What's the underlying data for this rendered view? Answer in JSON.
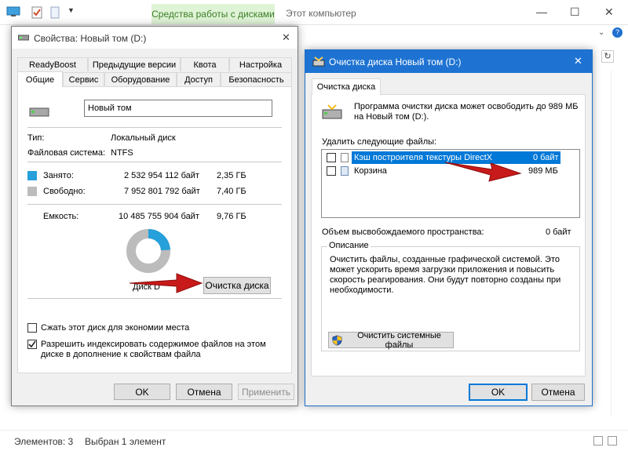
{
  "explorer": {
    "ribbon_tab": "Средства работы с дисками",
    "title": "Этот компьютер",
    "status_items": "Элементов: 3",
    "status_selected": "Выбран 1 элемент"
  },
  "properties": {
    "title": "Свойства: Новый том (D:)",
    "tabs_row1": [
      "ReadyBoost",
      "Предыдущие версии",
      "Квота",
      "Настройка"
    ],
    "tabs_row2": [
      "Общие",
      "Сервис",
      "Оборудование",
      "Доступ",
      "Безопасность"
    ],
    "volume_name": "Новый том",
    "type_label": "Тип:",
    "type_value": "Локальный диск",
    "fs_label": "Файловая система:",
    "fs_value": "NTFS",
    "used_label": "Занято:",
    "used_bytes": "2 532 954 112 байт",
    "used_gb": "2,35 ГБ",
    "free_label": "Свободно:",
    "free_bytes": "7 952 801 792 байт",
    "free_gb": "7,40 ГБ",
    "capacity_label": "Емкость:",
    "capacity_bytes": "10 485 755 904 байт",
    "capacity_gb": "9,76 ГБ",
    "used_fraction": 0.2416,
    "disk_label_partial": "Диск D",
    "cleanup_button": "Очистка диска",
    "compress_label": "Сжать этот диск для экономии места",
    "compress_checked": false,
    "index_label_line1": "Разрешить индексировать содержимое файлов на этом",
    "index_label_line2": "диске в дополнение к свойствам файла",
    "index_checked": true,
    "ok": "OK",
    "cancel": "Отмена",
    "apply": "Применить",
    "colors": {
      "used": "#26a0da",
      "free": "#bcbcbc"
    }
  },
  "cleanup": {
    "title": "Очистка диска Новый том (D:)",
    "tab": "Очистка диска",
    "intro_line1": "Программа очистки диска может освободить до 989 МБ",
    "intro_line2": "на Новый том (D:).",
    "files_label": "Удалить следующие файлы:",
    "files": [
      {
        "name": "Кэш построителя текстуры DirectX",
        "size": "0 байт",
        "selected": true,
        "checked": false
      },
      {
        "name": "Корзина",
        "size": "989 МБ",
        "selected": false,
        "checked": false
      }
    ],
    "space_label": "Объем высвобождаемого пространства:",
    "space_value": "0 байт",
    "desc_label": "Описание",
    "desc_lines": [
      "Очистить файлы, созданные графической системой. Это",
      "может ускорить время загрузки приложения и повысить",
      "скорость реагирования. Они будут повторно созданы при",
      "необходимости."
    ],
    "system_button": "Очистить системные файлы",
    "ok": "OK",
    "cancel": "Отмена"
  }
}
